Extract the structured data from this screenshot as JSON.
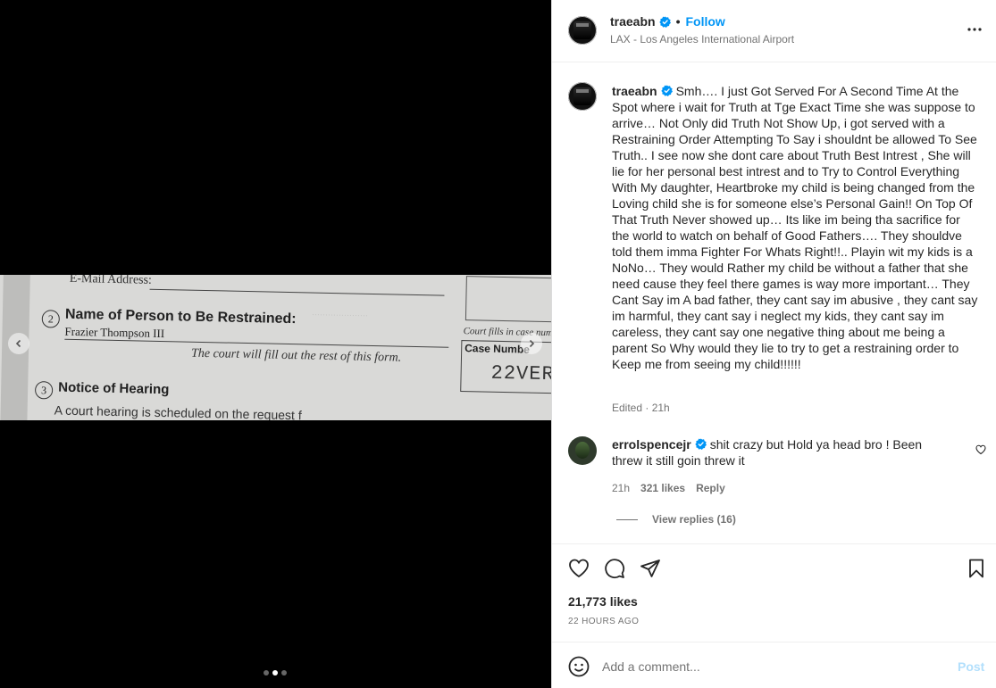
{
  "media": {
    "document": {
      "email_label": "E-Mail Address:",
      "section2_num": "2",
      "section2_title": "Name of Person to Be Restrained:",
      "restrained_name": "Frazier Thompson III",
      "court_note": "The court will fill out the rest of this form.",
      "section3_num": "3",
      "section3_title": "Notice of Hearing",
      "hearing_text": "A court hearing is scheduled on the request f",
      "court_fills": "Court fills in case num",
      "case_number_label": "Case Numbe",
      "case_number": "22VER"
    },
    "carousel": {
      "total": 3,
      "active_index": 1
    }
  },
  "header": {
    "username": "traeabn",
    "follow_label": "Follow",
    "location": "LAX - Los Angeles International Airport"
  },
  "caption": {
    "username": "traeabn",
    "text": "Smh…. I just Got Served For A Second Time At the Spot where i wait for Truth at Tge Exact Time she was suppose to arrive… Not Only did Truth Not Show Up, i got served with a Restraining Order Attempting To Say i shouldnt be allowed To See Truth.. I see now she dont care about Truth Best Intrest , She will lie for her personal best intrest and to Try to Control Everything With My daughter, Heartbroke my child is being changed from the Loving child she is for someone else’s Personal Gain!! On Top Of That Truth Never showed up… Its like im being tha sacrifice for the world to watch on behalf of Good Fathers…. They shouldve told them imma Fighter For Whats Right!!.. Playin wit my kids is a NoNo… They would Rather my child be without a father that she need cause they feel there games is way more important… They Cant Say im A bad father, they cant say im abusive , they cant say im harmful, they cant say i neglect my kids, they cant say im careless, they cant say one negative thing about me being a parent So Why would they lie to try to get a restraining order to Keep me from seeing my child!!!!!!",
    "edited": "Edited · 21h"
  },
  "comment": {
    "username": "errolspencejr",
    "text": "shit crazy but Hold ya head bro ! Been threw it still goin threw it",
    "time": "21h",
    "likes": "321 likes",
    "reply_label": "Reply",
    "view_replies": "View replies (16)"
  },
  "post_stats": {
    "likes": "21,773 likes",
    "time_ago": "22 HOURS AGO"
  },
  "add_comment": {
    "placeholder": "Add a comment...",
    "post_label": "Post"
  },
  "colors": {
    "accent": "#0095f6",
    "post_disabled": "#b2dffc",
    "muted": "#737373"
  }
}
